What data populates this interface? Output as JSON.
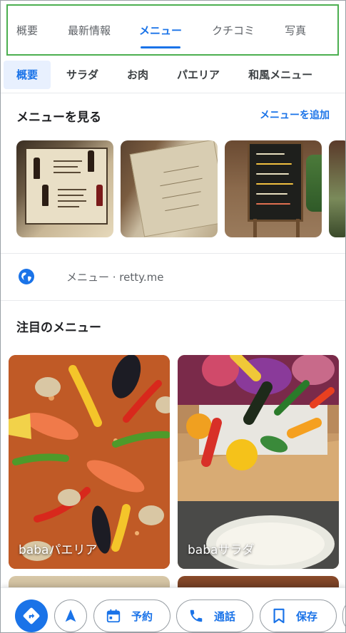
{
  "tabs": [
    {
      "label": "概要",
      "active": false
    },
    {
      "label": "最新情報",
      "active": false
    },
    {
      "label": "メニュー",
      "active": true
    },
    {
      "label": "クチコミ",
      "active": false
    },
    {
      "label": "写真",
      "active": false
    }
  ],
  "categories": [
    {
      "label": "概要",
      "active": true
    },
    {
      "label": "サラダ",
      "active": false
    },
    {
      "label": "お肉",
      "active": false
    },
    {
      "label": "パエリア",
      "active": false
    },
    {
      "label": "和風メニュー",
      "active": false
    }
  ],
  "menu_section": {
    "title": "メニューを見る",
    "add_label": "メニューを追加"
  },
  "website": {
    "text": "メニュー · retty.me",
    "icon": "globe-icon"
  },
  "featured": {
    "title": "注目のメニュー",
    "dishes": [
      {
        "label": "babaパエリア"
      },
      {
        "label": "babaサラダ"
      }
    ]
  },
  "actions": {
    "reserve_label": "予約",
    "call_label": "通話",
    "save_label": "保存"
  },
  "colors": {
    "accent": "#1a73e8",
    "highlight_border": "#4caf50",
    "chip_bg": "#e8f0fe"
  }
}
